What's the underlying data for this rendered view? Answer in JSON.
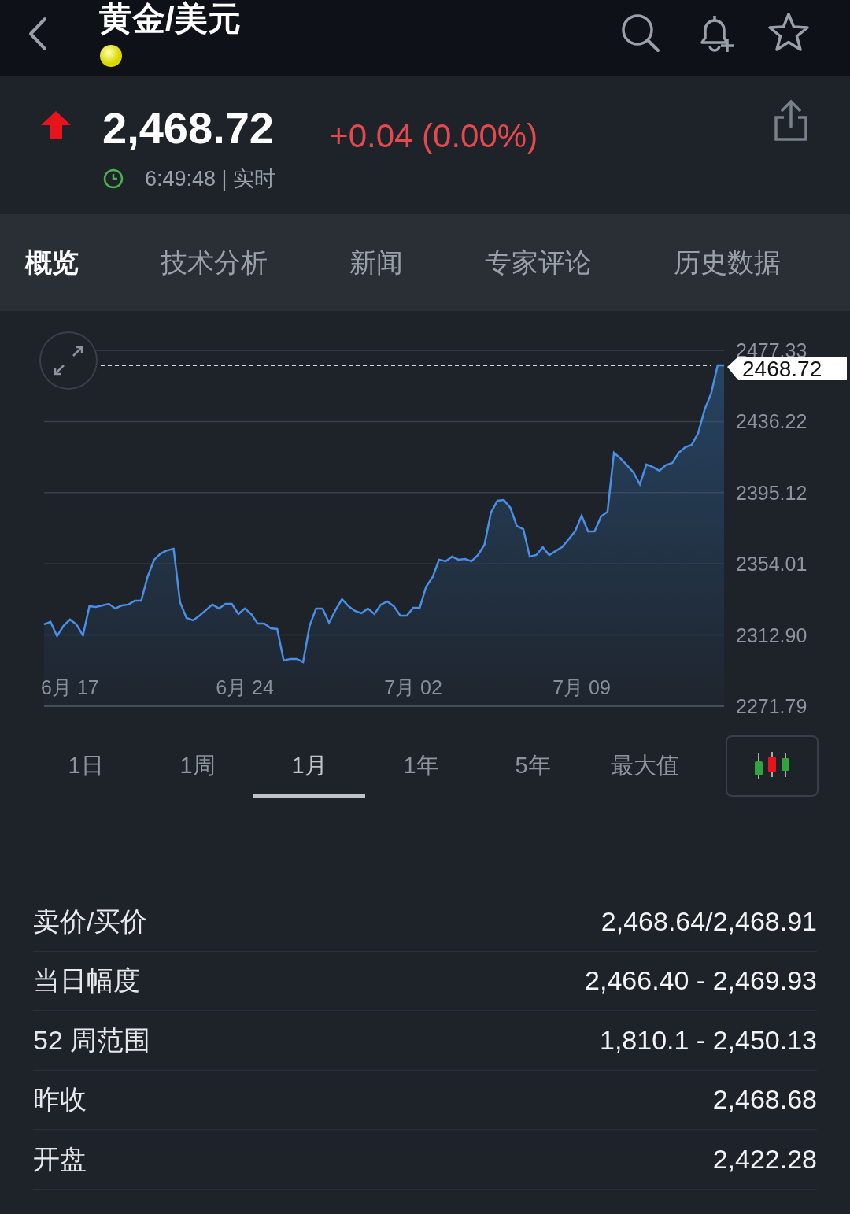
{
  "header": {
    "title": "黄金/美元"
  },
  "quote": {
    "price": "2,468.72",
    "change": "+0.04 (0.00%)",
    "time": "6:49:48 | 实时"
  },
  "tabs": [
    {
      "label": "概览",
      "selected": true
    },
    {
      "label": "技术分析",
      "selected": false
    },
    {
      "label": "新闻",
      "selected": false
    },
    {
      "label": "专家评论",
      "selected": false
    },
    {
      "label": "历史数据",
      "selected": false
    }
  ],
  "chart": {
    "chart_data": {
      "type": "area",
      "grid": true,
      "ref_lines": [
        {
          "axis": "y",
          "value": 2468.72,
          "label": "2468.72"
        }
      ],
      "categories": [
        null,
        null,
        null,
        null,
        "6月 17",
        null,
        null,
        null,
        null,
        null,
        null,
        null,
        null,
        null,
        null,
        null,
        null,
        null,
        null,
        null,
        null,
        null,
        null,
        null,
        null,
        null,
        null,
        null,
        null,
        null,
        null,
        "6月 24",
        null,
        null,
        null,
        null,
        null,
        null,
        null,
        null,
        null,
        null,
        null,
        null,
        null,
        null,
        null,
        null,
        null,
        null,
        null,
        null,
        null,
        null,
        null,
        null,
        null,
        "7月 02",
        null,
        null,
        null,
        null,
        null,
        null,
        null,
        null,
        null,
        null,
        null,
        null,
        null,
        null,
        null,
        null,
        null,
        null,
        null,
        null,
        null,
        null,
        null,
        null,
        null,
        "7月 09",
        null,
        null,
        null,
        null,
        null,
        null,
        null,
        null,
        null,
        null,
        null,
        null,
        null,
        null,
        null,
        null,
        null,
        null,
        null,
        null,
        null,
        null
      ],
      "series": [
        {
          "color": "#4a8fe7",
          "values": [
            2319.1,
            2320.5,
            2312.3,
            2318.2,
            2321.8,
            2319.1,
            2312.7,
            2329.6,
            2329.1,
            2330.0,
            2330.9,
            2328.2,
            2330.0,
            2330.5,
            2332.7,
            2332.7,
            2346.8,
            2356.4,
            2360.0,
            2361.8,
            2362.7,
            2331.8,
            2322.7,
            2321.4,
            2324.1,
            2327.3,
            2330.5,
            2328.2,
            2330.9,
            2330.9,
            2325.0,
            2328.2,
            2325.0,
            2319.5,
            2319.5,
            2316.8,
            2316.4,
            2298.2,
            2299.1,
            2299.1,
            2297.3,
            2318.2,
            2328.2,
            2328.2,
            2320.0,
            2327.3,
            2333.6,
            2329.6,
            2326.8,
            2325.5,
            2328.2,
            2325.0,
            2330.5,
            2332.3,
            2329.6,
            2324.1,
            2324.1,
            2328.6,
            2328.6,
            2340.9,
            2346.4,
            2356.4,
            2355.5,
            2358.2,
            2356.4,
            2356.8,
            2355.5,
            2359.1,
            2365.0,
            2383.7,
            2390.5,
            2390.9,
            2386.4,
            2375.9,
            2374.1,
            2358.2,
            2359.1,
            2363.7,
            2359.1,
            2361.4,
            2363.7,
            2368.2,
            2372.8,
            2381.8,
            2372.8,
            2372.8,
            2381.4,
            2384.1,
            2418.2,
            2415.0,
            2411.0,
            2406.9,
            2400.0,
            2411.4,
            2410.0,
            2407.8,
            2411.0,
            2412.3,
            2418.2,
            2421.4,
            2422.8,
            2429.6,
            2443.2,
            2452.3,
            2468.7,
            2468.7
          ]
        }
      ],
      "ylim": [
        2271.79,
        2477.33
      ],
      "yticks": [
        {
          "value": 2271.79,
          "label": "2271.79"
        },
        {
          "value": 2312.9,
          "label": "2312.90"
        },
        {
          "value": 2354.01,
          "label": "2354.01"
        },
        {
          "value": 2395.12,
          "label": "2395.12"
        },
        {
          "value": 2436.22,
          "label": "2436.22"
        },
        {
          "value": 2477.33,
          "label": "2477.33"
        }
      ]
    }
  },
  "ranges": [
    {
      "label": "1日",
      "selected": false
    },
    {
      "label": "1周",
      "selected": false
    },
    {
      "label": "1月",
      "selected": true
    },
    {
      "label": "1年",
      "selected": false
    },
    {
      "label": "5年",
      "selected": false
    },
    {
      "label": "最大值",
      "selected": false
    }
  ],
  "stats": [
    {
      "label": "卖价/买价",
      "value": "2,468.64/2,468.91"
    },
    {
      "label": "当日幅度",
      "value": "2,466.40 - 2,469.93"
    },
    {
      "label": "52 周范围",
      "value": "1,810.1 - 2,450.13"
    },
    {
      "label": "昨收",
      "value": "2,468.68"
    },
    {
      "label": "开盘",
      "value": "2,422.28"
    }
  ]
}
